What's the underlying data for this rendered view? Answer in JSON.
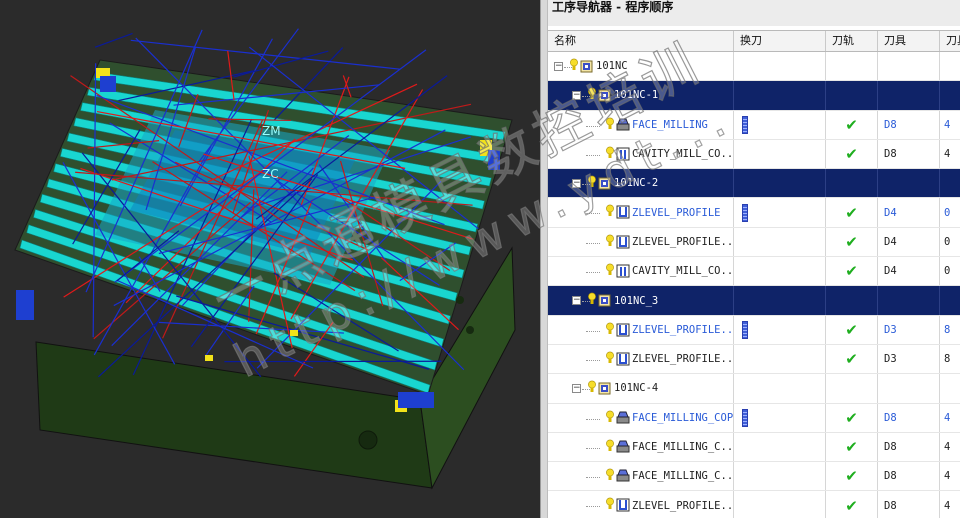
{
  "navigator": {
    "title": "工序导航器 - 程序顺序",
    "columns": {
      "name": "名称",
      "tool_change": "换刀",
      "toolpath": "刀轨",
      "tool": "刀具",
      "tool_number": "刀具"
    },
    "rows": [
      {
        "level": 0,
        "kind": "group",
        "name": "101NC",
        "expanded": true,
        "selected": false,
        "tool_change": false,
        "toolpath": false,
        "tool": "",
        "tool_number": ""
      },
      {
        "level": 1,
        "kind": "group",
        "name": "101NC-1",
        "expanded": true,
        "selected": true,
        "tool_change": false,
        "toolpath": false,
        "tool": "",
        "tool_number": ""
      },
      {
        "level": 2,
        "kind": "face",
        "name": "FACE_MILLING",
        "blue": true,
        "selected": false,
        "tool_change": true,
        "toolpath": true,
        "tool": "D8",
        "tool_number": "4"
      },
      {
        "level": 2,
        "kind": "cavity",
        "name": "CAVITY_MILL_CO...",
        "blue": false,
        "selected": false,
        "tool_change": false,
        "toolpath": true,
        "tool": "D8",
        "tool_number": "4"
      },
      {
        "level": 1,
        "kind": "group",
        "name": "101NC-2",
        "expanded": true,
        "selected": true,
        "tool_change": false,
        "toolpath": false,
        "tool": "",
        "tool_number": ""
      },
      {
        "level": 2,
        "kind": "zlevel",
        "name": "ZLEVEL_PROFILE",
        "blue": true,
        "selected": false,
        "tool_change": true,
        "toolpath": true,
        "tool": "D4",
        "tool_number": "0"
      },
      {
        "level": 2,
        "kind": "zlevel",
        "name": "ZLEVEL_PROFILE...",
        "blue": false,
        "selected": false,
        "tool_change": false,
        "toolpath": true,
        "tool": "D4",
        "tool_number": "0"
      },
      {
        "level": 2,
        "kind": "cavity",
        "name": "CAVITY_MILL_CO...",
        "blue": false,
        "selected": false,
        "tool_change": false,
        "toolpath": true,
        "tool": "D4",
        "tool_number": "0"
      },
      {
        "level": 1,
        "kind": "group",
        "name": "101NC_3",
        "expanded": true,
        "selected": true,
        "tool_change": false,
        "toolpath": false,
        "tool": "",
        "tool_number": ""
      },
      {
        "level": 2,
        "kind": "zlevel",
        "name": "ZLEVEL_PROFILE...",
        "blue": true,
        "selected": false,
        "tool_change": true,
        "toolpath": true,
        "tool": "D3",
        "tool_number": "8"
      },
      {
        "level": 2,
        "kind": "zlevel",
        "name": "ZLEVEL_PROFILE...",
        "blue": false,
        "selected": false,
        "tool_change": false,
        "toolpath": true,
        "tool": "D3",
        "tool_number": "8"
      },
      {
        "level": 1,
        "kind": "group",
        "name": "101NC-4",
        "expanded": true,
        "selected": false,
        "tool_change": false,
        "toolpath": false,
        "tool": "",
        "tool_number": ""
      },
      {
        "level": 2,
        "kind": "face",
        "name": "FACE_MILLING_COPY",
        "blue": true,
        "selected": false,
        "tool_change": true,
        "toolpath": true,
        "tool": "D8",
        "tool_number": "4"
      },
      {
        "level": 2,
        "kind": "face",
        "name": "FACE_MILLING_C...",
        "blue": false,
        "selected": false,
        "tool_change": false,
        "toolpath": true,
        "tool": "D8",
        "tool_number": "4"
      },
      {
        "level": 2,
        "kind": "face",
        "name": "FACE_MILLING_C...",
        "blue": false,
        "selected": false,
        "tool_change": false,
        "toolpath": true,
        "tool": "D8",
        "tool_number": "4"
      },
      {
        "level": 2,
        "kind": "zlevel",
        "name": "ZLEVEL_PROFILE...",
        "blue": false,
        "selected": false,
        "tool_change": false,
        "toolpath": true,
        "tool": "D8",
        "tool_number": "4"
      }
    ]
  },
  "viewport": {
    "label_zm": "ZM",
    "label_zc": "ZC"
  },
  "watermark": {
    "cn_text": "一点通模具数控培训",
    "url_text": "http://www.ydt..."
  },
  "colors": {
    "selected_row": "#0f2368",
    "link_blue": "#2a5bd7",
    "check_green": "#1fae1f",
    "plate_cyan": "#19d6d0",
    "plate_green": "#2a4a1e"
  },
  "icons": {
    "expander": "minus-box-icon",
    "status": "lightbulb-icon",
    "group": "program-group-icon",
    "face": "face-milling-icon",
    "cavity": "cavity-mill-icon",
    "zlevel": "zlevel-profile-icon",
    "tool_change": "tool-change-icon",
    "toolpath": "checkmark-icon"
  }
}
